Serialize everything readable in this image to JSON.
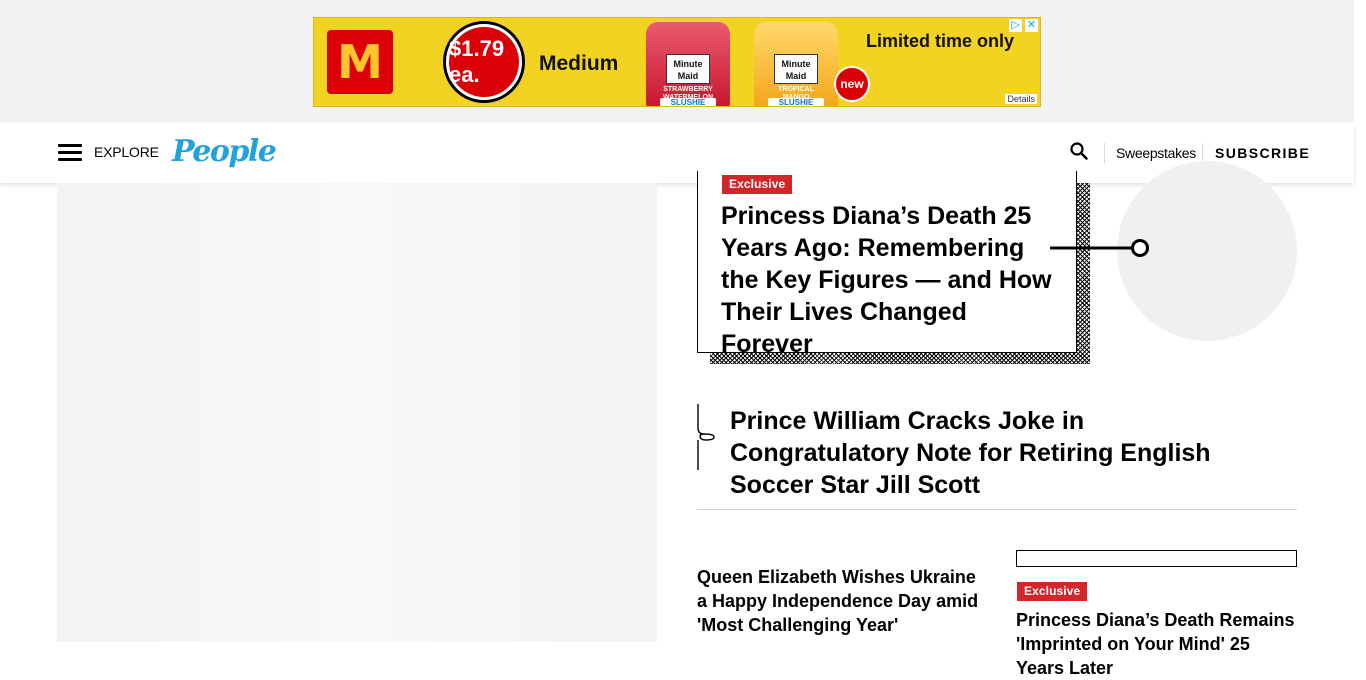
{
  "ad": {
    "brand_mark": "M",
    "price": "$1.79 ea.",
    "size_label": "Medium",
    "cup1": {
      "brand": "Minute Maid",
      "flavor": "STRAWBERRY WATERMELON",
      "product": "SLUSHIE"
    },
    "cup2": {
      "brand": "Minute Maid",
      "flavor": "TROPICAL MANGO",
      "product": "SLUSHIE"
    },
    "headline": "Limited time only",
    "new_badge": "new",
    "details": "Details",
    "adchoices_icon": "▷",
    "close_icon": "✕"
  },
  "nav": {
    "explore": "EXPLORE",
    "logo": "People",
    "sweepstakes": "Sweepstakes",
    "subscribe": "SUBSCRIBE"
  },
  "stories": {
    "hero": {
      "badge": "Exclusive",
      "title": "Princess Diana’s Death 25 Years Ago: Remembering the Key Figures — and How Their Lives Changed Forever"
    },
    "second": {
      "title": "Prince William Cracks Joke in Congratulatory Note for Retiring English Soccer Star Jill Scott"
    },
    "third": {
      "title": "Queen Elizabeth Wishes Ukraine a Happy Independence Day amid 'Most Challenging Year'"
    },
    "fourth": {
      "badge": "Exclusive",
      "title": "Princess Diana’s Death Remains 'Imprinted on Your Mind' 25 Years Later"
    }
  },
  "colors": {
    "accent_blue": "#22a2da",
    "badge_red": "#d3262b",
    "ad_yellow": "#f3d321",
    "mcd_red": "#db0007"
  }
}
